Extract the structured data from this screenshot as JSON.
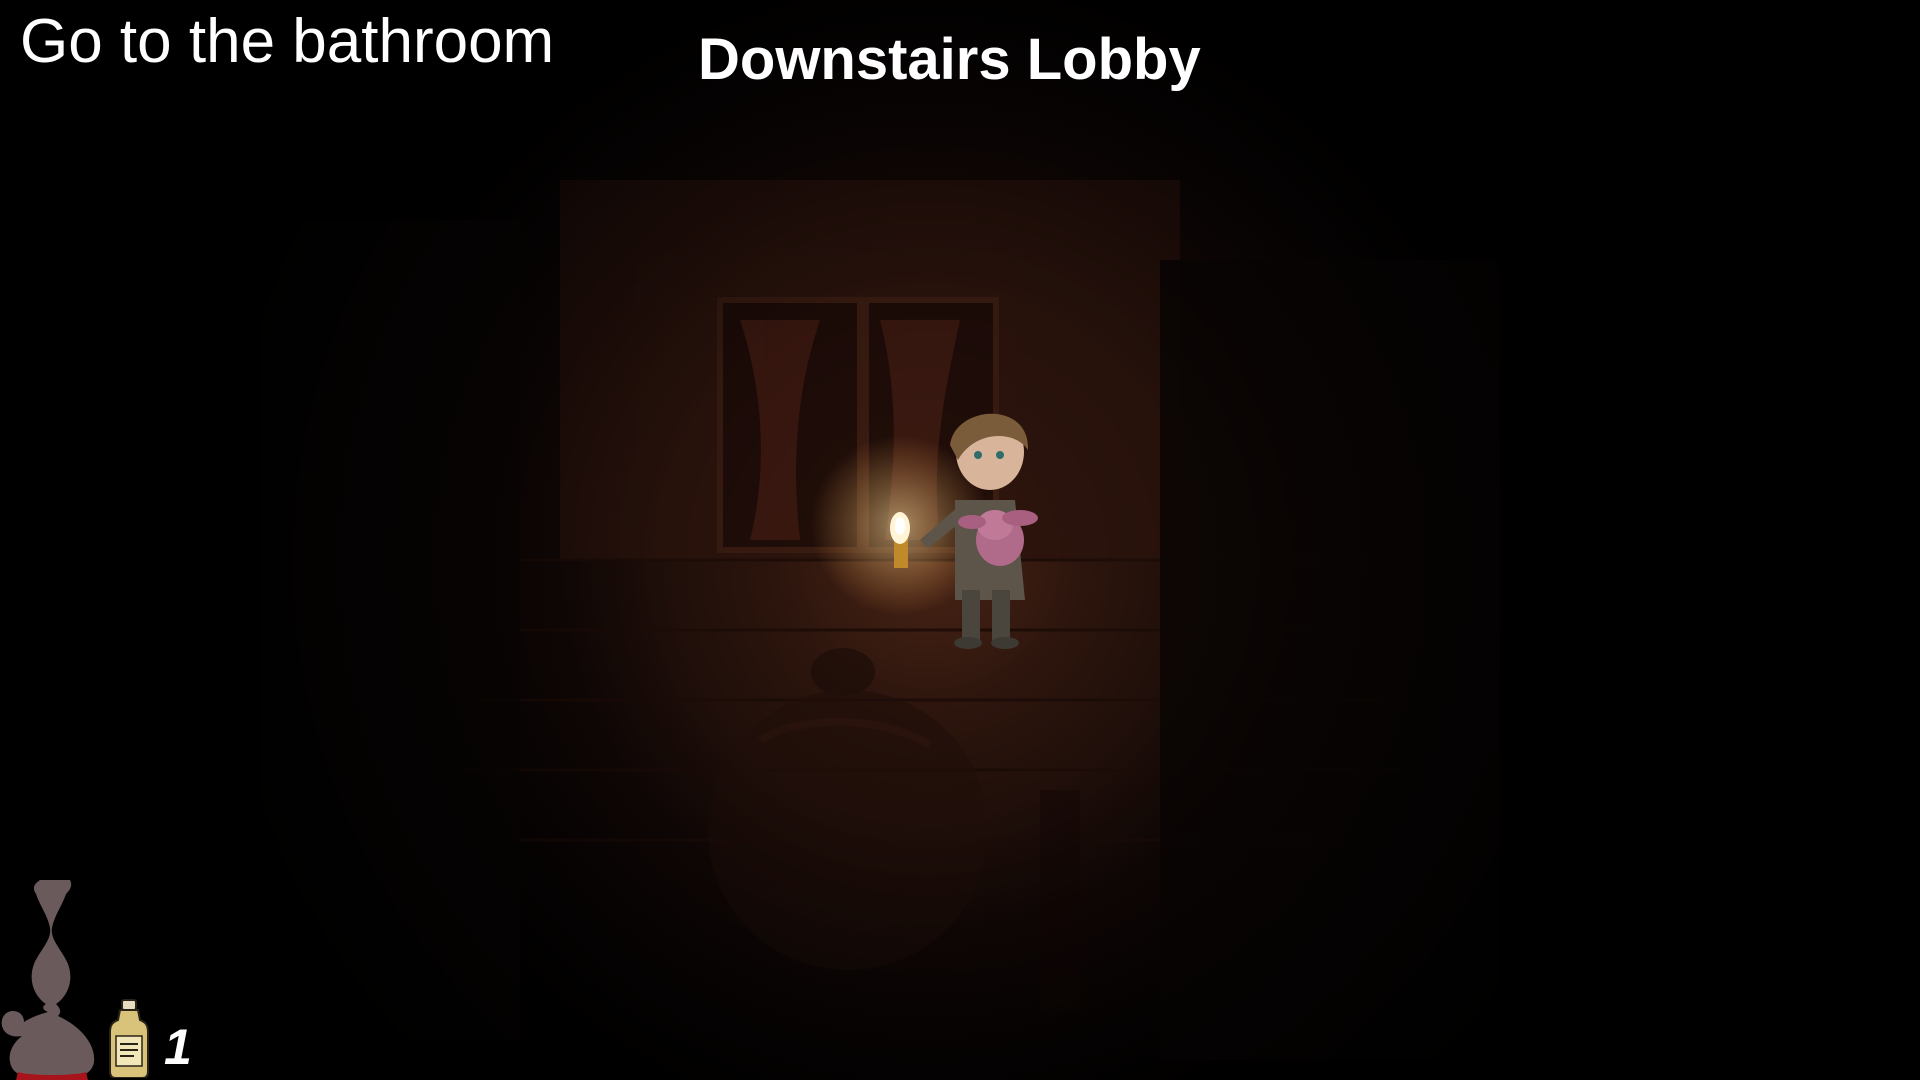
{
  "hud": {
    "objective": "Go to the bathroom",
    "location": "Downstairs Lobby",
    "oil_count": "1",
    "lamp_fill": 0.0
  },
  "icons": {
    "lamp": "oil-lamp-icon",
    "oil": "lamp-oil-bottle-icon"
  },
  "colors": {
    "background": "#000000",
    "text": "#ffffff",
    "lamp_silhouette": "#6b5a5c",
    "lamp_base": "#a8141c",
    "candle_glow": "#ffd98a"
  }
}
